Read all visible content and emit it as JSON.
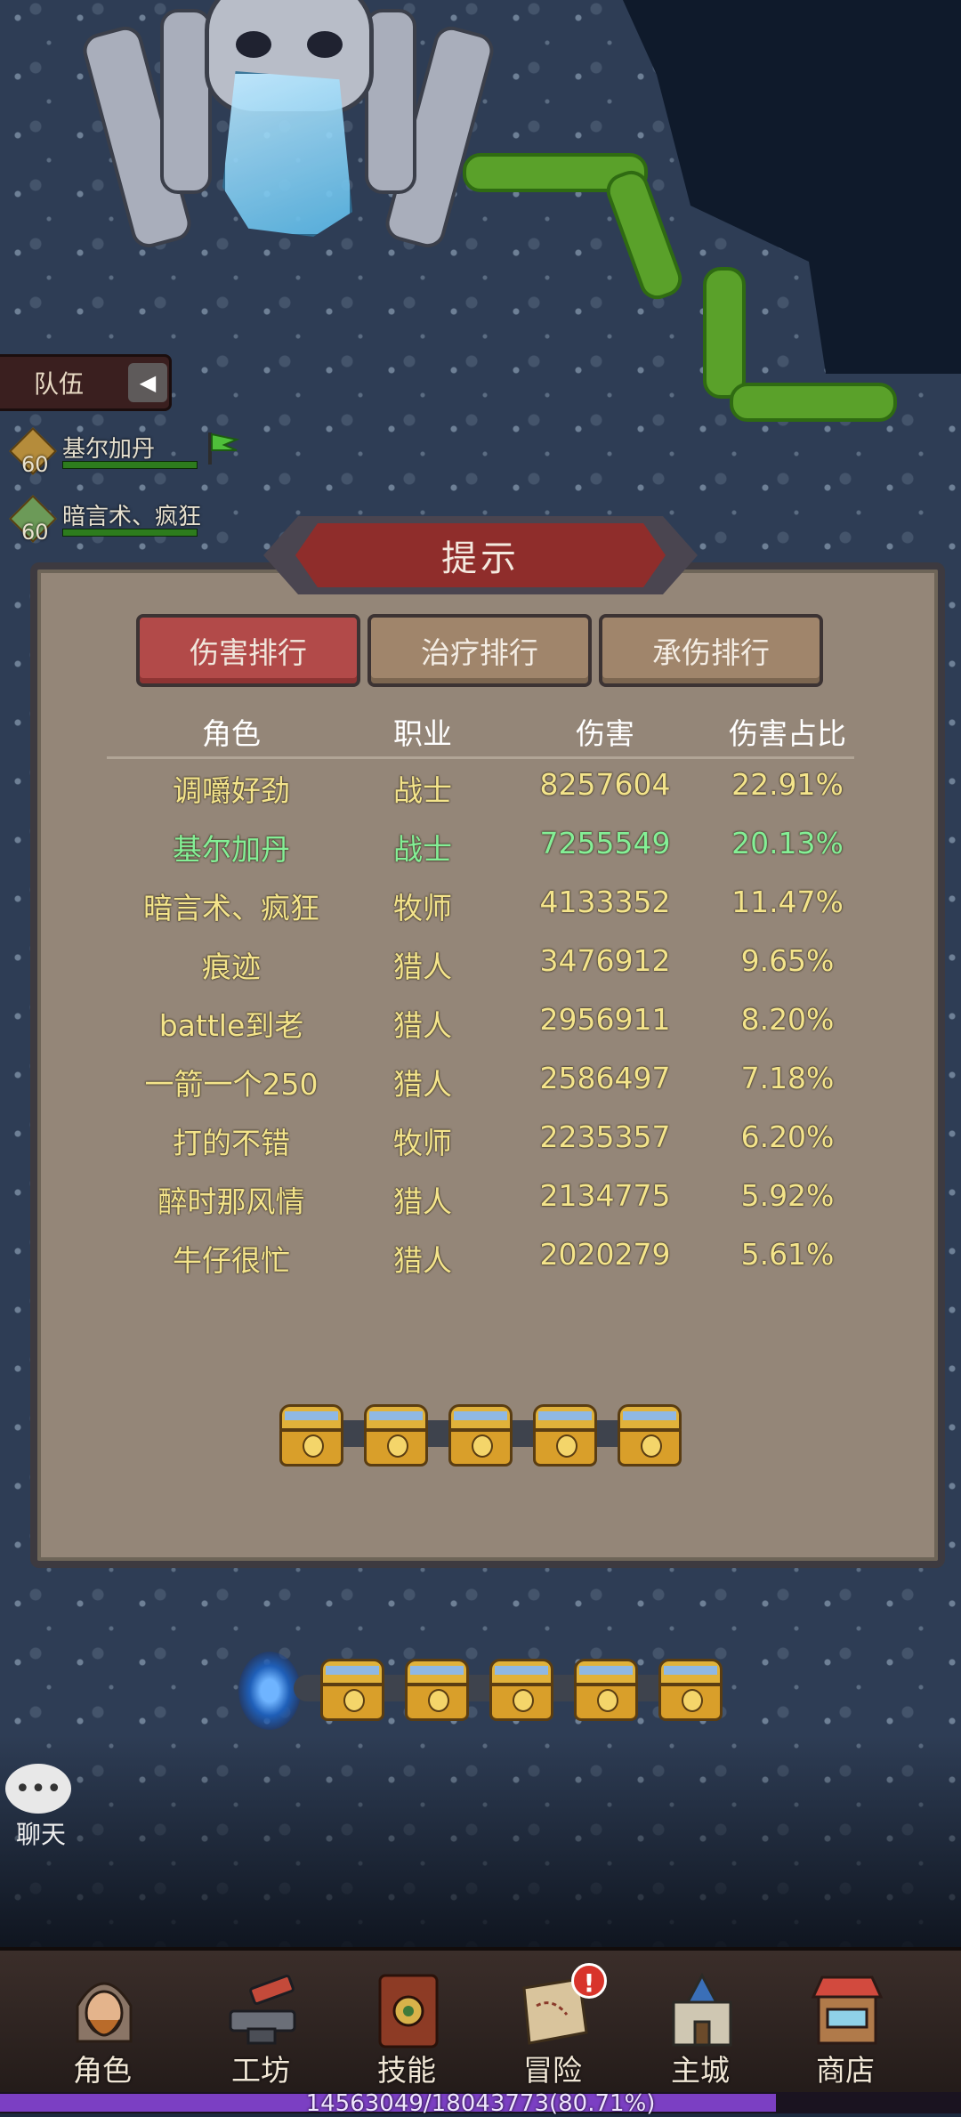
{
  "party": {
    "tab_label": "队伍",
    "members": [
      {
        "level": "60",
        "name": "基尔加丹",
        "leader": true
      },
      {
        "level": "60",
        "name": "暗言术、疯狂",
        "leader": false
      }
    ]
  },
  "dialog": {
    "title": "提示",
    "tabs": [
      {
        "label": "伤害排行",
        "active": true
      },
      {
        "label": "治疗排行",
        "active": false
      },
      {
        "label": "承伤排行",
        "active": false
      }
    ],
    "columns": [
      "角色",
      "职业",
      "伤害",
      "伤害占比"
    ],
    "rows": [
      {
        "name": "调嚼好劲",
        "class": "战士",
        "damage": "8257604",
        "share": "22.91%",
        "self": false
      },
      {
        "name": "基尔加丹",
        "class": "战士",
        "damage": "7255549",
        "share": "20.13%",
        "self": true
      },
      {
        "name": "暗言术、疯狂",
        "class": "牧师",
        "damage": "4133352",
        "share": "11.47%",
        "self": false
      },
      {
        "name": "痕迹",
        "class": "猎人",
        "damage": "3476912",
        "share": "9.65%",
        "self": false
      },
      {
        "name": "battle到老",
        "class": "猎人",
        "damage": "2956911",
        "share": "8.20%",
        "self": false
      },
      {
        "name": "一箭一个250",
        "class": "猎人",
        "damage": "2586497",
        "share": "7.18%",
        "self": false
      },
      {
        "name": "打的不错",
        "class": "牧师",
        "damage": "2235357",
        "share": "6.20%",
        "self": false
      },
      {
        "name": "醉时那风情",
        "class": "猎人",
        "damage": "2134775",
        "share": "5.92%",
        "self": false
      },
      {
        "name": "牛仔很忙",
        "class": "猎人",
        "damage": "2020279",
        "share": "5.61%",
        "self": false
      }
    ],
    "chest_count": 5
  },
  "map": {
    "chest_count": 5
  },
  "chat": {
    "label": "聊天",
    "icon": "chat-bubble-icon"
  },
  "nav": [
    {
      "label": "角色",
      "icon": "hero-portrait-icon",
      "badge": ""
    },
    {
      "label": "工坊",
      "icon": "anvil-hammer-icon",
      "badge": ""
    },
    {
      "label": "技能",
      "icon": "spellbook-icon",
      "badge": ""
    },
    {
      "label": "冒险",
      "icon": "scroll-map-icon",
      "badge": "!"
    },
    {
      "label": "主城",
      "icon": "castle-icon",
      "badge": ""
    },
    {
      "label": "商店",
      "icon": "shop-stall-icon",
      "badge": ""
    }
  ],
  "exp": {
    "text": "14563049/18043773(80.71%)",
    "percent": 80.71
  },
  "colors": {
    "accent_red": "#b24a49",
    "self_green": "#84ef96",
    "row_yellow": "#f4e48b",
    "exp_purple": "#7b3fc3"
  }
}
